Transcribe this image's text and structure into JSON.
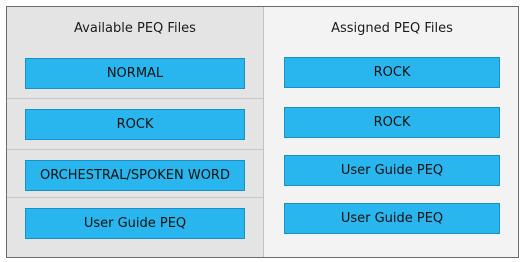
{
  "available": {
    "title": "Available PEQ Files",
    "items": [
      "NORMAL",
      "ROCK",
      "ORCHESTRAL/SPOKEN WORD",
      "User Guide PEQ"
    ]
  },
  "assigned": {
    "title": "Assigned PEQ Files",
    "items": [
      "ROCK",
      "ROCK",
      "User Guide PEQ",
      "User Guide PEQ"
    ]
  }
}
